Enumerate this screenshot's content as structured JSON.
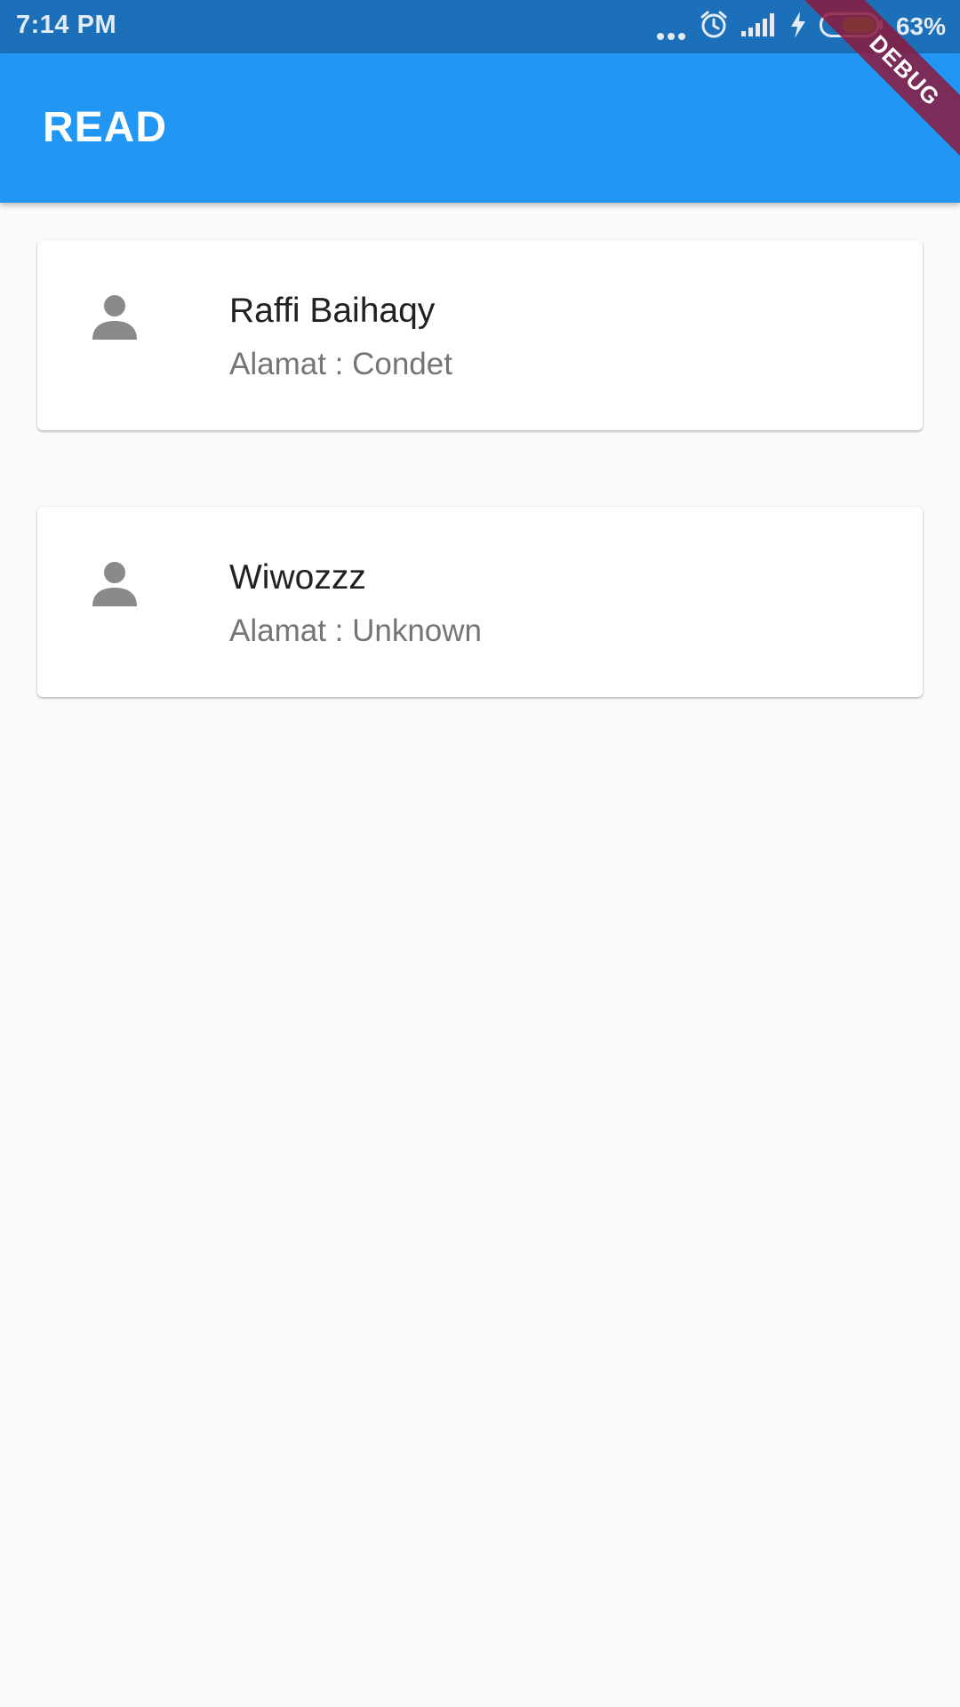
{
  "status_bar": {
    "time": "7:14 PM",
    "battery_percent": "63%",
    "battery_level": 0.63,
    "icons": [
      "more-dots-icon",
      "alarm-icon",
      "signal-icon",
      "charging-icon",
      "battery-icon"
    ]
  },
  "app_bar": {
    "title": "READ",
    "color": "#2196f3"
  },
  "debug_banner": {
    "label": "DEBUG"
  },
  "contacts": [
    {
      "icon": "person-icon",
      "name": "Raffi Baihaqy",
      "address": "Alamat : Condet"
    },
    {
      "icon": "person-icon",
      "name": "Wiwozzz",
      "address": "Alamat : Unknown"
    }
  ]
}
